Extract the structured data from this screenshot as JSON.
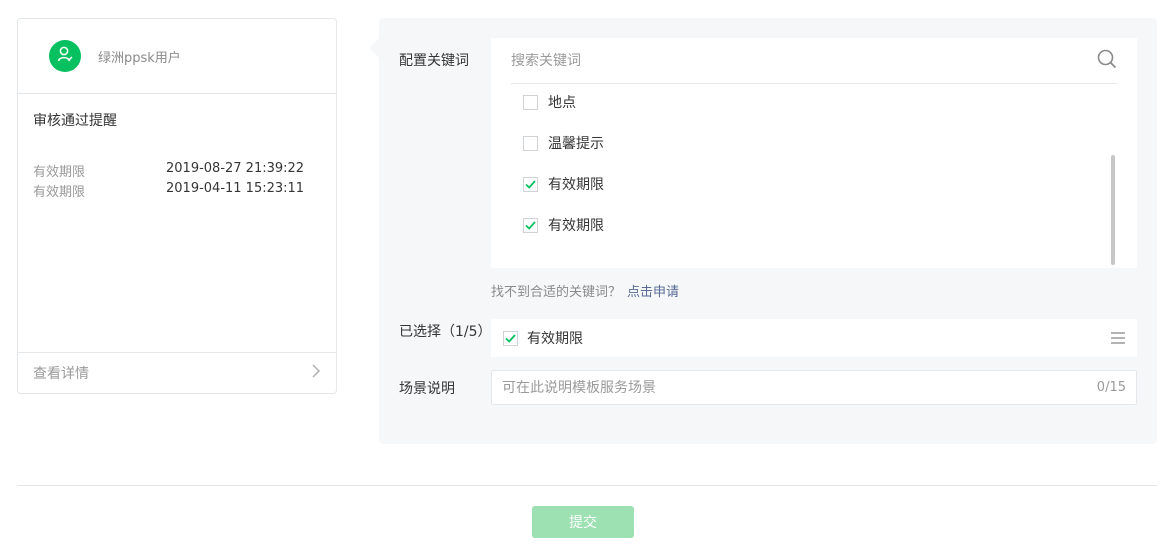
{
  "preview_card": {
    "account_name": "绿洲ppsk用户",
    "template_title": "审核通过提醒",
    "fields": [
      {
        "key": "有效期限",
        "value": "2019-08-27 21:39:22"
      },
      {
        "key": "有效期限",
        "value": "2019-04-11 15:23:11"
      }
    ],
    "view_details_label": "查看详情"
  },
  "config": {
    "keywords_label": "配置关键词",
    "search": {
      "placeholder": "搜索关键词",
      "value": ""
    },
    "keyword_options": [
      {
        "label": "地点",
        "checked": false
      },
      {
        "label": "温馨提示",
        "checked": false
      },
      {
        "label": "有效期限",
        "checked": true
      },
      {
        "label": "有效期限",
        "checked": true
      }
    ],
    "hint_text": "找不到合适的关键词？",
    "apply_link": "点击申请",
    "selected_label": "已选择（1/5）",
    "selected_items": [
      {
        "label": "有效期限",
        "checked": true
      }
    ],
    "scene_label": "场景说明",
    "scene_input": {
      "placeholder": "可在此说明模板服务场景",
      "value": ""
    },
    "scene_counter": "0/15"
  },
  "submit_label": "提交",
  "colors": {
    "brand_green": "#07c160",
    "submit_disabled": "#9de0b2",
    "link": "#576b95",
    "panel_bg": "#f6f7f9"
  },
  "icons": [
    "user-icon",
    "chevron-right-icon",
    "search-icon",
    "checkmark-icon",
    "drag-handle-icon"
  ]
}
